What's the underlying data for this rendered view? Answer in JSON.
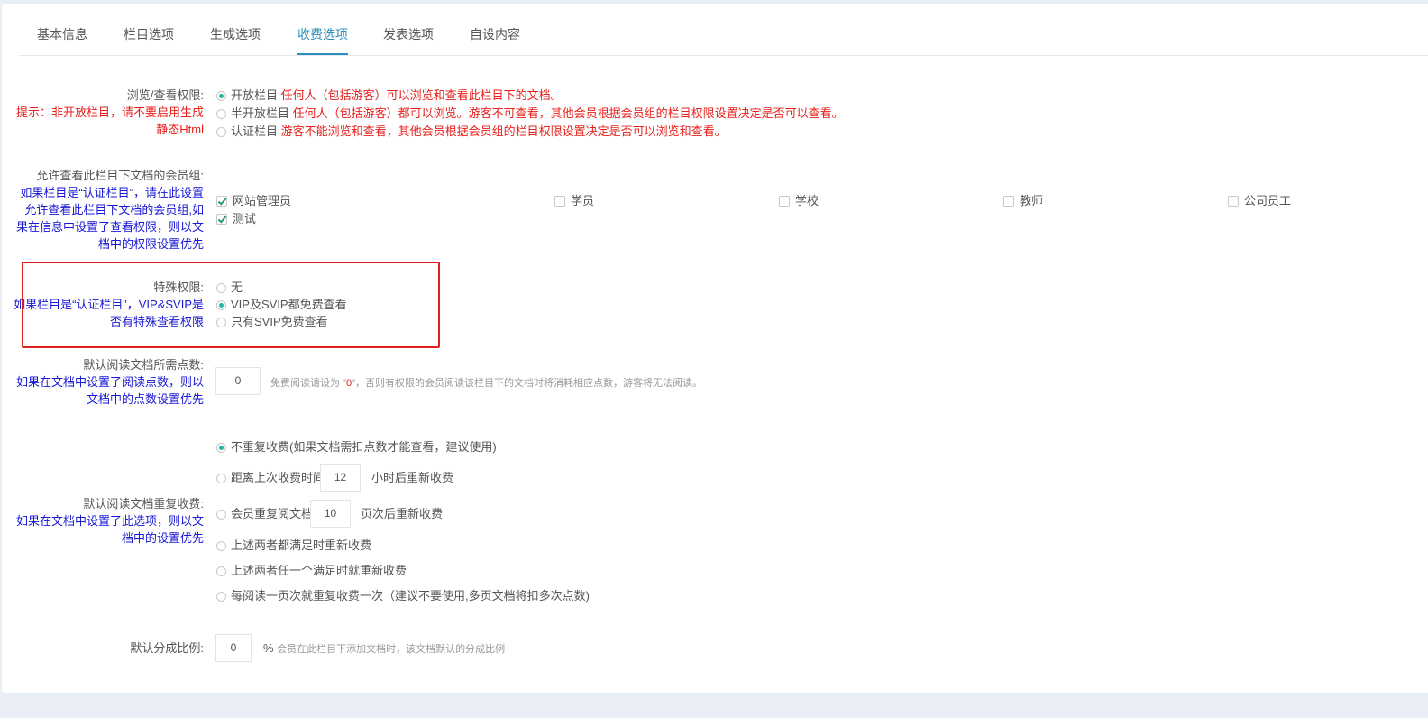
{
  "tabs": [
    {
      "label": "基本信息"
    },
    {
      "label": "栏目选项"
    },
    {
      "label": "生成选项"
    },
    {
      "label": "收费选项"
    },
    {
      "label": "发表选项"
    },
    {
      "label": "自设内容"
    }
  ],
  "view_perm": {
    "label": "浏览/查看权限:",
    "tip": "提示：非开放栏目，请不要启用生成静态Html",
    "tip_line1": "提示：非开放栏目，请不要启用生成",
    "tip_line2": "静态Html",
    "options": [
      {
        "name": "开放栏目",
        "desc": "任何人（包括游客）可以浏览和查看此栏目下的文档。"
      },
      {
        "name": "半开放栏目",
        "desc": "任何人（包括游客）都可以浏览。游客不可查看，其他会员根据会员组的栏目权限设置决定是否可以查看。"
      },
      {
        "name": "认证栏目",
        "desc": "游客不能浏览和查看，其他会员根据会员组的栏目权限设置决定是否可以浏览和查看。"
      }
    ]
  },
  "groups": {
    "label": "允许查看此栏目下文档的会员组:",
    "note_lines": [
      "如果栏目是“认证栏目”，请在此设置",
      "允许查看此栏目下文档的会员组,如",
      "果在信息中设置了查看权限，则以文",
      "档中的权限设置优先"
    ],
    "items": [
      {
        "label": "网站管理员",
        "checked": true
      },
      {
        "label": "学员",
        "checked": false
      },
      {
        "label": "学校",
        "checked": false
      },
      {
        "label": "教师",
        "checked": false
      },
      {
        "label": "公司员工",
        "checked": false
      },
      {
        "label": "测试",
        "checked": true
      }
    ]
  },
  "special": {
    "label": "特殊权限:",
    "note_lines": [
      "如果栏目是“认证栏目”，VIP&SVIP是",
      "否有特殊查看权限"
    ],
    "options": [
      {
        "label": "无"
      },
      {
        "label": "VIP及SVIP都免费查看"
      },
      {
        "label": "只有SVIP免费查看"
      }
    ]
  },
  "points": {
    "label": "默认阅读文档所需点数:",
    "note_lines": [
      "如果在文档中设置了阅读点数，则以",
      "文档中的点数设置优先"
    ],
    "value": "0",
    "hint_pre": "免费阅读请设为 \"",
    "hint_val": "0",
    "hint_post": "\"，否则有权限的会员阅读该栏目下的文档时将消耗相应点数，游客将无法阅读。"
  },
  "repeat": {
    "label": "默认阅读文档重复收费:",
    "note_lines": [
      "如果在文档中设置了此选项，则以文",
      "档中的设置优先"
    ],
    "opt1": "不重复收费(如果文档需扣点数才能查看，建议使用)",
    "opt2_pre": "距离上次收费时间",
    "opt2_val": "12",
    "opt2_post": "小时后重新收费",
    "opt3_pre": "会员重复阅文档",
    "opt3_val": "10",
    "opt3_post": "页次后重新收费",
    "opt4": "上述两者都满足时重新收费",
    "opt5": "上述两者任一个满足时就重新收费",
    "opt6": "每阅读一页次就重复收费一次（建议不要使用,多页文档将扣多次点数)"
  },
  "share": {
    "label": "默认分成比例:",
    "value": "0",
    "unit": "%",
    "hint": "会员在此栏目下添加文档时，该文档默认的分成比例"
  },
  "colors": {
    "accent": "#2a8fbd",
    "radio_on": "#23b7a4",
    "note_blue": "#1818d6",
    "note_red": "#e8201c",
    "highlight": "#e02020"
  }
}
